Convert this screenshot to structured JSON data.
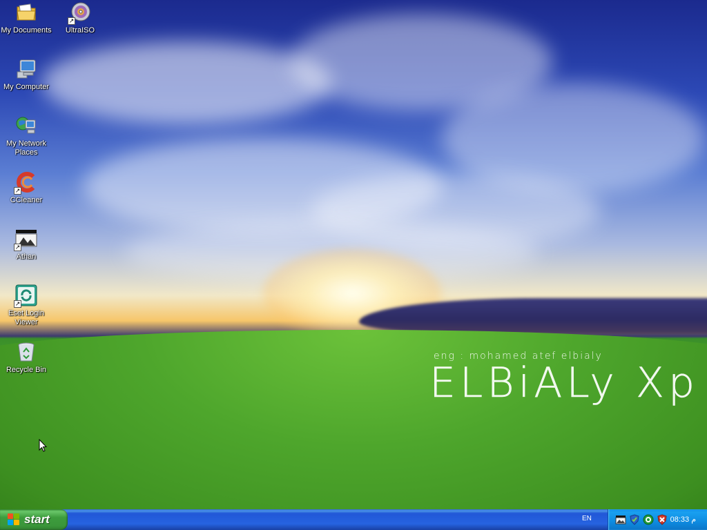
{
  "desktop": {
    "icons": [
      {
        "label": "My Documents",
        "icon": "folder-documents-icon"
      },
      {
        "label": "UltraISO",
        "icon": "disc-icon"
      },
      {
        "label": "My Computer",
        "icon": "computer-icon"
      },
      {
        "label": "My Network Places",
        "icon": "network-icon"
      },
      {
        "label": "CCleaner",
        "icon": "ccleaner-icon"
      },
      {
        "label": "Athan",
        "icon": "athan-icon"
      },
      {
        "label": "Eset Login Viewer",
        "icon": "eset-icon"
      },
      {
        "label": "Recycle Bin",
        "icon": "recycle-bin-icon"
      }
    ],
    "wallpaper": {
      "subtitle": "eng : mohamed atef elbialy",
      "title": "ELBiALy Xp"
    }
  },
  "taskbar": {
    "start_label": "start",
    "language": "EN",
    "clock": "08:33 م",
    "tray_icons": [
      "network-tray-icon",
      "shield-update-tray-icon",
      "green-circle-tray-icon",
      "antivirus-tray-icon"
    ]
  },
  "colors": {
    "taskbar_blue": "#2663e0",
    "start_green": "#3d9c3d",
    "tray_blue": "#0e8be0"
  }
}
